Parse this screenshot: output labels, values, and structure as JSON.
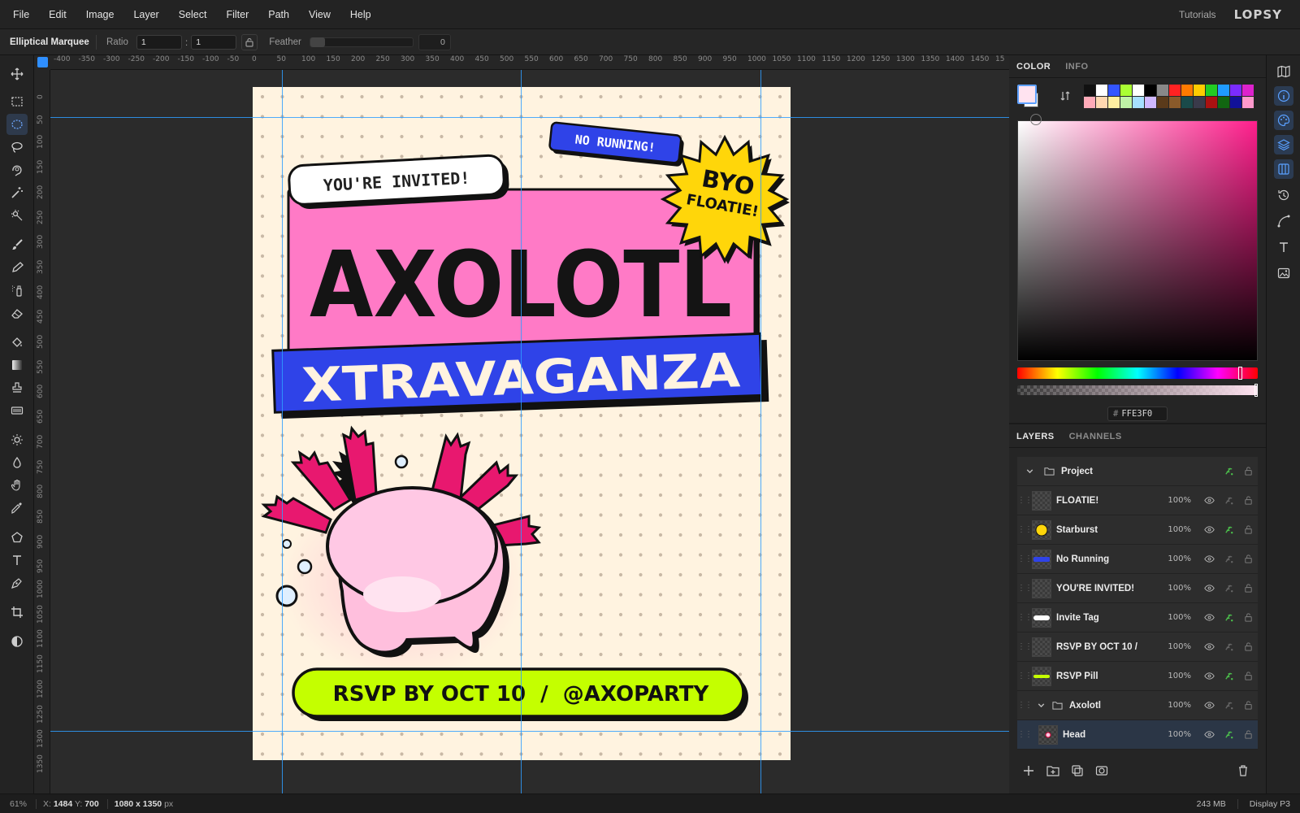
{
  "menu": [
    "File",
    "Edit",
    "Image",
    "Layer",
    "Select",
    "Filter",
    "Path",
    "View",
    "Help"
  ],
  "menu_right": {
    "tutorials": "Tutorials",
    "brand": "LOPSY"
  },
  "options": {
    "tool_name": "Elliptical Marquee",
    "ratio_label": "Ratio",
    "ratio_w": "1",
    "ratio_sep": ":",
    "ratio_h": "1",
    "feather_label": "Feather",
    "feather_value": "0"
  },
  "ruler_top_ticks": [
    "-400",
    "-350",
    "-300",
    "-250",
    "-200",
    "-150",
    "-100",
    "-50",
    "0",
    "50",
    "100",
    "150",
    "200",
    "250",
    "300",
    "350",
    "400",
    "450",
    "500",
    "550",
    "600",
    "650",
    "700",
    "750",
    "800",
    "850",
    "900",
    "950",
    "1000",
    "1050",
    "1100",
    "1150",
    "1200",
    "1250",
    "1300",
    "1350",
    "1400",
    "1450",
    "15"
  ],
  "ruler_left_ticks": [
    "0",
    "50",
    "100",
    "150",
    "200",
    "250",
    "300",
    "350",
    "400",
    "450",
    "500",
    "550",
    "600",
    "650",
    "700",
    "750",
    "800",
    "850",
    "900",
    "950",
    "1000",
    "1050",
    "1100",
    "1150",
    "1200",
    "1250",
    "1300",
    "1350"
  ],
  "poster": {
    "invite": "YOU'RE INVITED!",
    "no_running": "NO RUNNING!",
    "byo_1": "BYO",
    "byo_2": "FLOATIE!",
    "title": "AXOLOTL",
    "subtitle": "XTRAVAGANZA",
    "rsvp": "RSVP BY OCT 10  /  @AXOPARTY",
    "bg_color": "#FFF3E0",
    "pink": "#FF7AC6",
    "blue": "#2F43E8",
    "lime": "#C4FF00",
    "yellow": "#FFD60A"
  },
  "color_panel": {
    "tabs": [
      "COLOR",
      "INFO"
    ],
    "foreground": "#FFE3F0",
    "hex": "FFE3F0",
    "hash": "#",
    "swatches": [
      "#111111",
      "#ffffff",
      "#3355ff",
      "#aaff33",
      "#ffffff",
      "#000000",
      "#888888",
      "#ff2222",
      "#ff7a00",
      "#ffcc00",
      "#22cc22",
      "#1f9bff",
      "#7a2cff",
      "#dd22cc",
      "#ffaab8",
      "#ffd7b0",
      "#ffeea0",
      "#bff2a6",
      "#a6e0ff",
      "#d0b8ff",
      "#5a3a1a",
      "#8a5a2a",
      "#1a4a4a",
      "#3a3a4a",
      "#aa1111",
      "#116611",
      "#111199",
      "#ff99cc"
    ]
  },
  "layers_panel": {
    "tabs": [
      "LAYERS",
      "CHANNELS"
    ],
    "layers": [
      {
        "name": "Project",
        "opacity": "",
        "type": "group",
        "indent": 0
      },
      {
        "name": "FLOATIE!",
        "opacity": "100%",
        "type": "text"
      },
      {
        "name": "Starburst",
        "opacity": "100%",
        "type": "starburst"
      },
      {
        "name": "No Running",
        "opacity": "100%",
        "type": "badge"
      },
      {
        "name": "YOU'RE INVITED!",
        "opacity": "100%",
        "type": "text"
      },
      {
        "name": "Invite Tag",
        "opacity": "100%",
        "type": "tag"
      },
      {
        "name": "RSVP BY OCT 10 /",
        "opacity": "100%",
        "type": "text"
      },
      {
        "name": "RSVP Pill",
        "opacity": "100%",
        "type": "pill"
      },
      {
        "name": "Axolotl",
        "opacity": "100%",
        "type": "group"
      },
      {
        "name": "Head",
        "opacity": "100%",
        "type": "head"
      }
    ]
  },
  "status": {
    "zoom": "61%",
    "x_label": "X:",
    "x": "1484",
    "y_label": "Y:",
    "y": "700",
    "dims": "1080 x 1350",
    "dims_unit": "px",
    "memory": "243 MB",
    "display": "Display P3"
  }
}
